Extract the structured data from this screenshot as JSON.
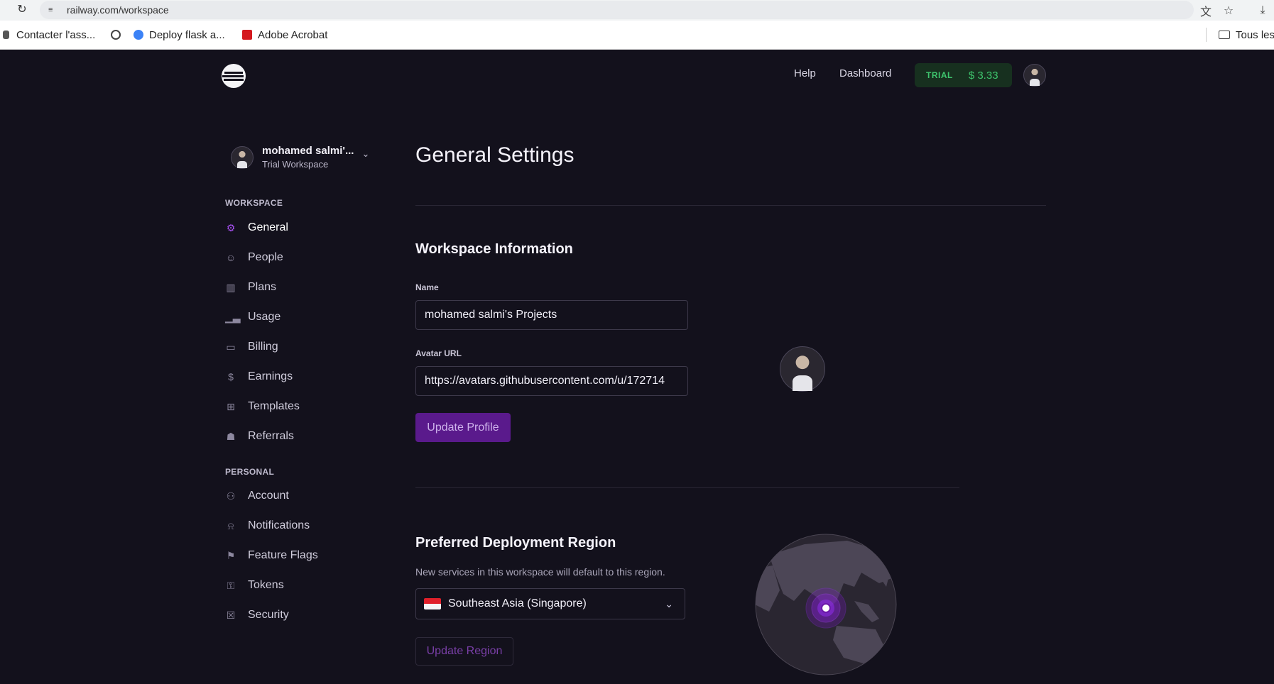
{
  "browser": {
    "url": "railway.com/workspace",
    "bookmarks": [
      {
        "label": "Contacter l'ass..."
      },
      {
        "label": ""
      },
      {
        "label": "Deploy flask a..."
      },
      {
        "label": "Adobe Acrobat"
      }
    ],
    "bookmarks_folder": "Tous les"
  },
  "header": {
    "help": "Help",
    "dashboard": "Dashboard",
    "trial_label": "TRIAL",
    "trial_amount": "$ 3.33"
  },
  "sidebar": {
    "workspace_name": "mohamed salmi'...",
    "workspace_type": "Trial Workspace",
    "workspace_section": "WORKSPACE",
    "personal_section": "PERSONAL",
    "workspace_items": [
      {
        "label": "General",
        "icon": "gear-icon",
        "active": true
      },
      {
        "label": "People",
        "icon": "people-icon"
      },
      {
        "label": "Plans",
        "icon": "plans-icon"
      },
      {
        "label": "Usage",
        "icon": "chart-icon"
      },
      {
        "label": "Billing",
        "icon": "card-icon"
      },
      {
        "label": "Earnings",
        "icon": "dollar-icon"
      },
      {
        "label": "Templates",
        "icon": "template-icon"
      },
      {
        "label": "Referrals",
        "icon": "gift-icon"
      }
    ],
    "personal_items": [
      {
        "label": "Account",
        "icon": "user-icon"
      },
      {
        "label": "Notifications",
        "icon": "bell-icon"
      },
      {
        "label": "Feature Flags",
        "icon": "flag-icon"
      },
      {
        "label": "Tokens",
        "icon": "key-icon"
      },
      {
        "label": "Security",
        "icon": "lock-icon"
      }
    ]
  },
  "main": {
    "title": "General Settings",
    "workspace_info": {
      "heading": "Workspace Information",
      "name_label": "Name",
      "name_value": "mohamed salmi's Projects",
      "avatar_label": "Avatar URL",
      "avatar_value": "https://avatars.githubusercontent.com/u/172714",
      "update_button": "Update Profile"
    },
    "region": {
      "heading": "Preferred Deployment Region",
      "description": "New services in this workspace will default to this region.",
      "selected": "Southeast Asia (Singapore)",
      "update_button": "Update Region"
    }
  },
  "colors": {
    "background": "#13111c",
    "accent": "#5a1a8c",
    "trial_green": "#3ec46d"
  }
}
